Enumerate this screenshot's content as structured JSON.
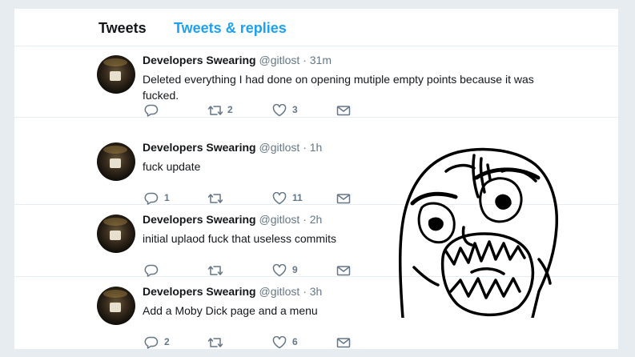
{
  "tabs": {
    "tweets": "Tweets",
    "tweets_replies": "Tweets & replies"
  },
  "colors": {
    "accent": "#1da1f2",
    "background": "#e6ecf0",
    "text": "#14171a",
    "muted": "#657786"
  },
  "tweets": [
    {
      "name": "Developers Swearing",
      "handle": "@gitlost",
      "dot": "·",
      "time": "31m",
      "text": "Deleted everything I had done on opening mutiple empty points because it was fucked.",
      "replies": "",
      "retweets": "2",
      "likes": "3"
    },
    {
      "name": "Developers Swearing",
      "handle": "@gitlost",
      "dot": "·",
      "time": "1h",
      "text": "fuck update",
      "replies": "1",
      "retweets": "",
      "likes": "11"
    },
    {
      "name": "Developers Swearing",
      "handle": "@gitlost",
      "dot": "·",
      "time": "2h",
      "text": "initial uplaod fuck that useless commits",
      "replies": "",
      "retweets": "",
      "likes": "9"
    },
    {
      "name": "Developers Swearing",
      "handle": "@gitlost",
      "dot": "·",
      "time": "3h",
      "text": "Add a Moby Dick page and a menu",
      "replies": "2",
      "retweets": "",
      "likes": "6"
    }
  ],
  "icons": {
    "reply": "reply-icon",
    "retweet": "retweet-icon",
    "like": "heart-icon",
    "dm": "envelope-icon",
    "meme": "rage-face-icon"
  }
}
